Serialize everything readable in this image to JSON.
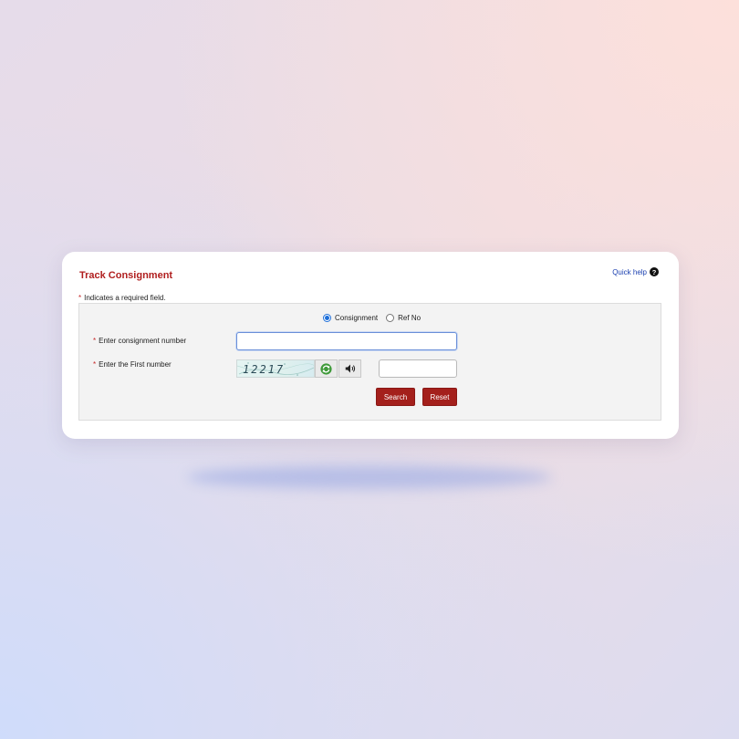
{
  "form": {
    "title": "Track Consignment",
    "quick_help": "Quick help",
    "required_star": "*",
    "required_note": "Indicates a required field.",
    "search_type": {
      "options": [
        "Consignment",
        "Ref No"
      ],
      "selected": "Consignment"
    },
    "consignment_label": "Enter consignment number",
    "consignment_value": "",
    "captcha_label": "Enter the First number",
    "captcha_text": "12217",
    "captcha_answer": "",
    "search_button": "Search",
    "reset_button": "Reset"
  },
  "colors": {
    "accent": "#b01e1e",
    "button": "#a4201c",
    "link": "#1a3fb0",
    "radio_selected": "#1e6fd9"
  },
  "icons": {
    "help": "question-circle-icon",
    "refresh": "refresh-icon",
    "audio": "speaker-icon"
  }
}
